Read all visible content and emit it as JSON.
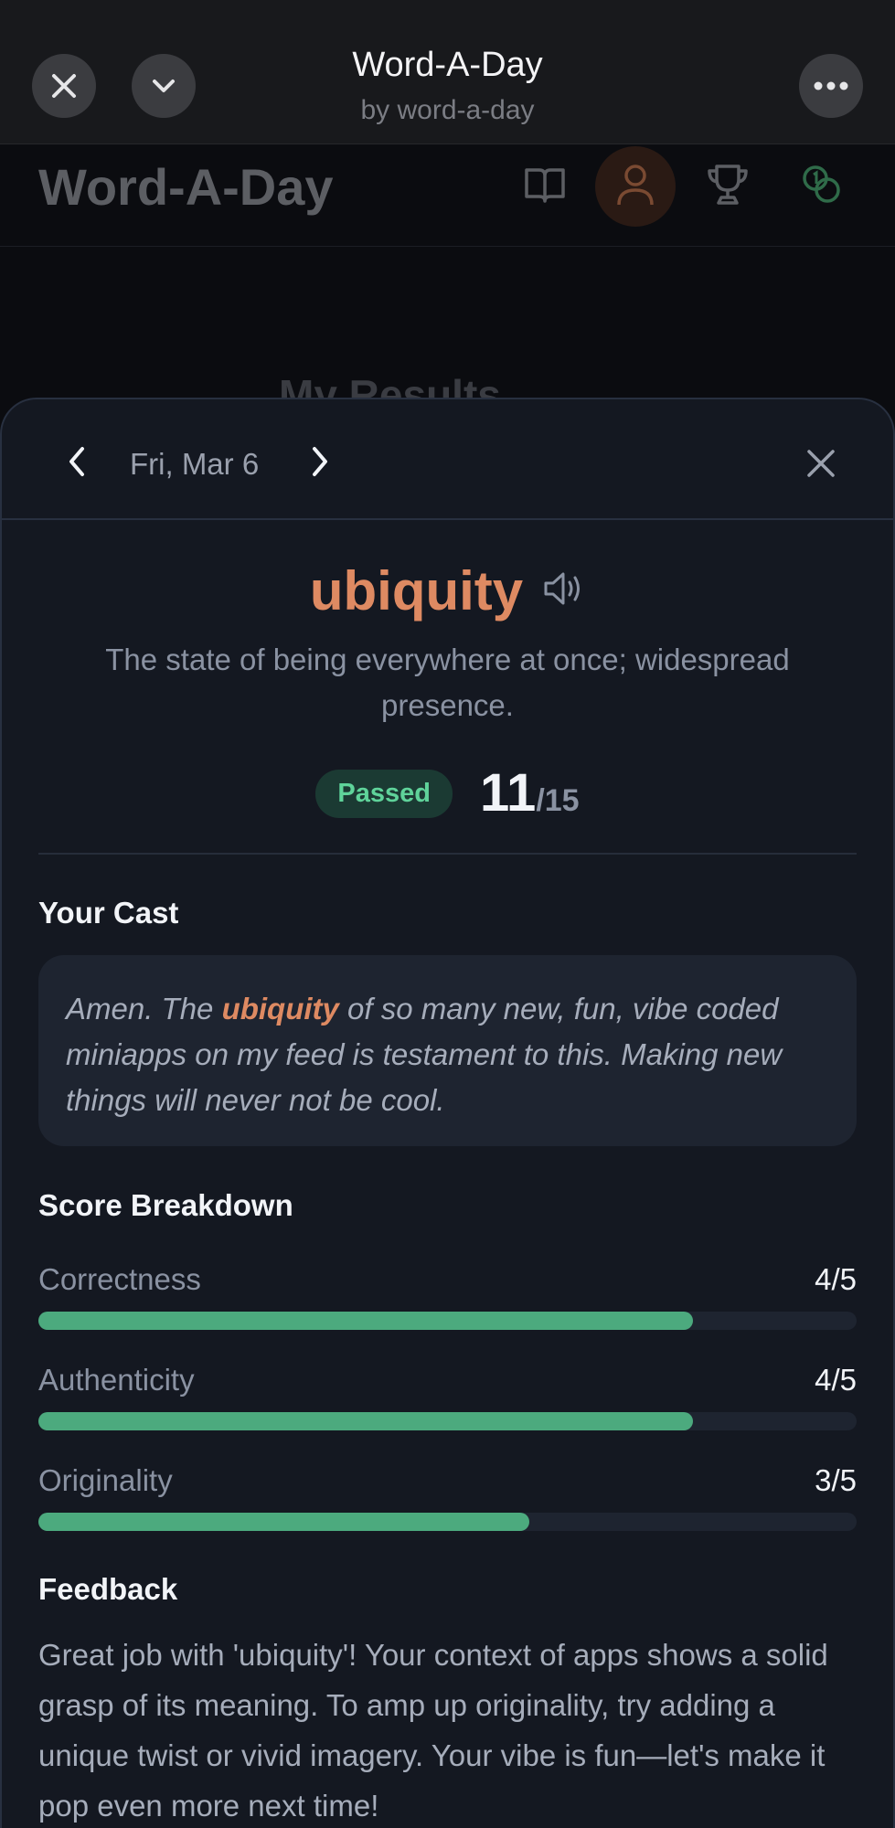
{
  "host": {
    "title": "Word-A-Day",
    "subtitle": "by word-a-day"
  },
  "app": {
    "logo": "Word-A-Day",
    "nav_icons": [
      "book-icon",
      "user-icon",
      "trophy-icon",
      "coins-icon"
    ],
    "page_title": "My Results"
  },
  "sheet": {
    "date": "Fri, Mar 6",
    "word": "ubiquity",
    "definition": "The state of being everywhere at once; widespread presence.",
    "status": "Passed",
    "score": "11",
    "score_max": "/15",
    "cast_heading": "Your Cast",
    "cast": {
      "before": "Amen. The ",
      "highlight": "ubiquity",
      "after": " of so many new, fun, vibe coded miniapps on my feed is testament to this. Making new things will never not be cool."
    },
    "breakdown_heading": "Score Breakdown",
    "metrics": [
      {
        "label": "Correctness",
        "value": "4/5",
        "fraction": 0.8
      },
      {
        "label": "Authenticity",
        "value": "4/5",
        "fraction": 0.8
      },
      {
        "label": "Originality",
        "value": "3/5",
        "fraction": 0.6
      }
    ],
    "feedback_heading": "Feedback",
    "feedback": "Great job with 'ubiquity'! Your context of apps shows a solid grasp of its meaning. To amp up originality, try adding a unique twist or vivid imagery. Your vibe is fun—let's make it pop even more next time!"
  },
  "colors": {
    "accent": "#de8a62",
    "success": "#4caa7e",
    "badge_text": "#5fd39a"
  }
}
